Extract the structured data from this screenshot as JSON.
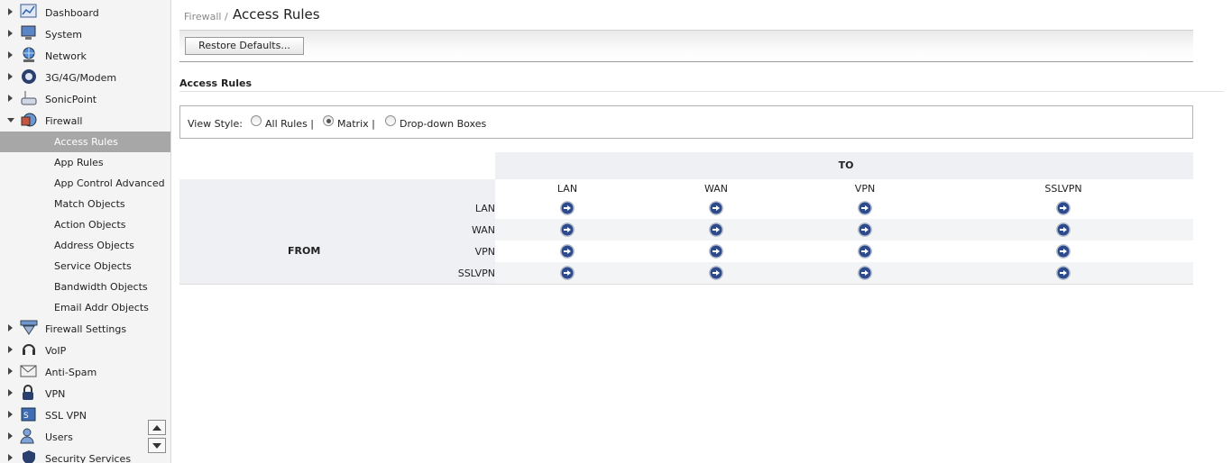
{
  "sidebar": {
    "items": [
      {
        "label": "Dashboard",
        "icon": "dashboard-icon"
      },
      {
        "label": "System",
        "icon": "system-icon"
      },
      {
        "label": "Network",
        "icon": "network-icon"
      },
      {
        "label": "3G/4G/Modem",
        "icon": "modem-icon"
      },
      {
        "label": "SonicPoint",
        "icon": "sonicpoint-icon"
      },
      {
        "label": "Firewall",
        "icon": "firewall-icon",
        "expanded": true
      },
      {
        "label": "Firewall Settings",
        "icon": "firewall-settings-icon"
      },
      {
        "label": "VoIP",
        "icon": "voip-icon"
      },
      {
        "label": "Anti-Spam",
        "icon": "anti-spam-icon"
      },
      {
        "label": "VPN",
        "icon": "vpn-icon"
      },
      {
        "label": "SSL VPN",
        "icon": "ssl-vpn-icon"
      },
      {
        "label": "Users",
        "icon": "users-icon"
      },
      {
        "label": "Security Services",
        "icon": "security-services-icon"
      }
    ],
    "firewall_subitems": [
      {
        "label": "Access Rules",
        "active": true
      },
      {
        "label": "App Rules"
      },
      {
        "label": "App Control Advanced"
      },
      {
        "label": "Match Objects"
      },
      {
        "label": "Action Objects"
      },
      {
        "label": "Address Objects"
      },
      {
        "label": "Service Objects"
      },
      {
        "label": "Bandwidth Objects"
      },
      {
        "label": "Email Addr Objects"
      }
    ]
  },
  "header": {
    "breadcrumb": "Firewall /",
    "title": "Access Rules"
  },
  "toolbar": {
    "restore_label": "Restore Defaults..."
  },
  "section": {
    "title": "Access Rules"
  },
  "view_style": {
    "label": "View Style:",
    "options": [
      {
        "label": "All Rules |",
        "selected": false
      },
      {
        "label": "Matrix |",
        "selected": true
      },
      {
        "label": "Drop-down Boxes",
        "selected": false
      }
    ]
  },
  "matrix": {
    "to_label": "TO",
    "from_label": "FROM",
    "columns": [
      "LAN",
      "WAN",
      "VPN",
      "SSLVPN"
    ],
    "rows": [
      "LAN",
      "WAN",
      "VPN",
      "SSLVPN"
    ],
    "cell_icon": "arrow-right-circle-icon"
  },
  "colors": {
    "active_nav": "#a7a7a7",
    "go_button": "#2d4a8c",
    "matrix_header_bg": "#eef0f3"
  }
}
